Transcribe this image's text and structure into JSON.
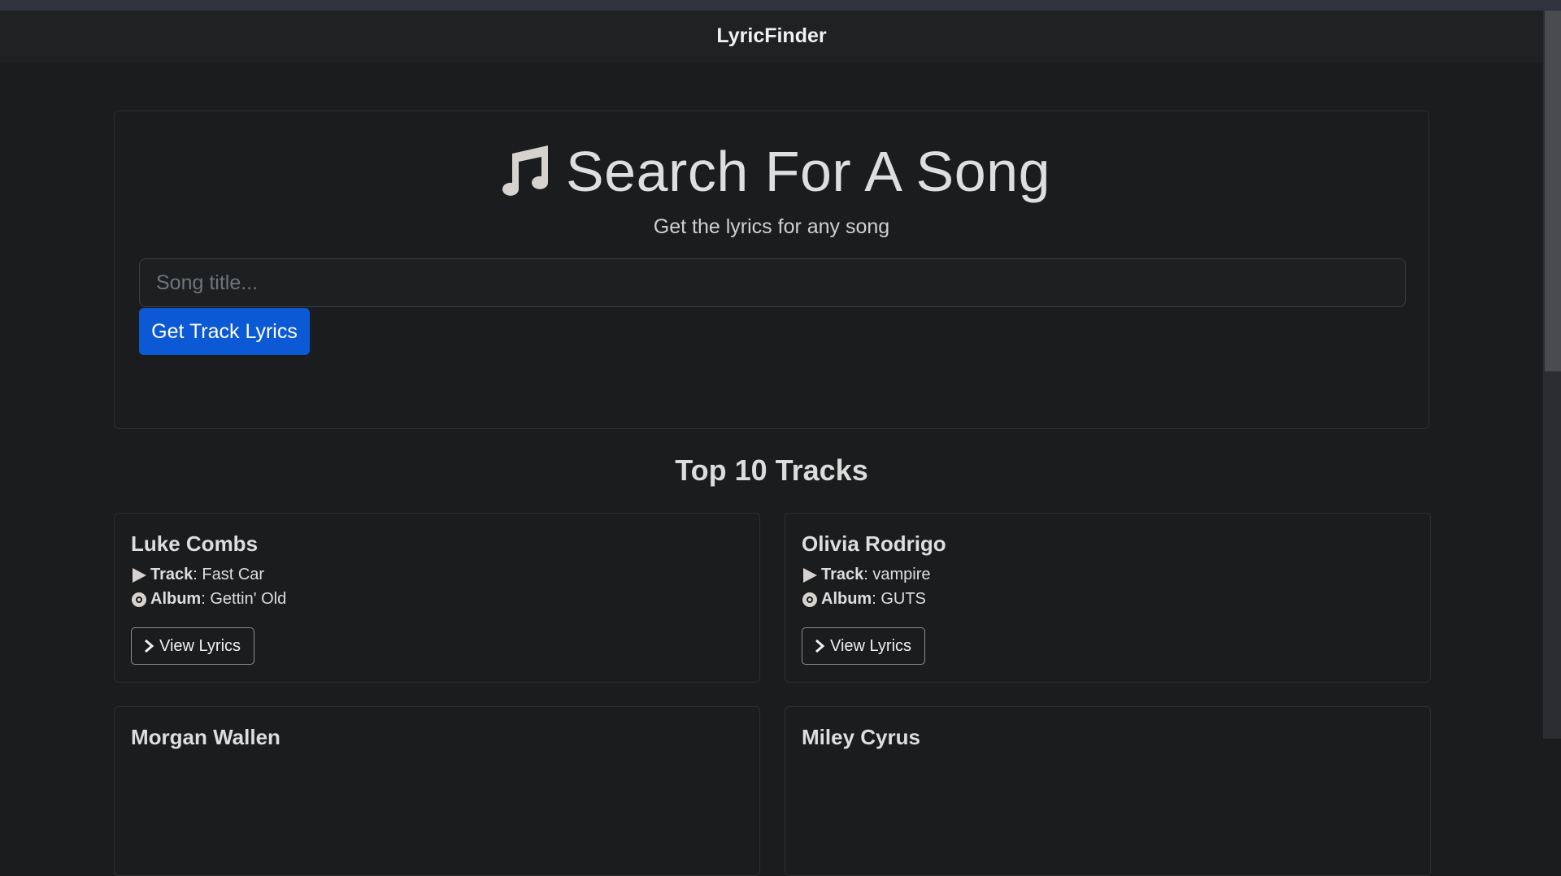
{
  "navbar": {
    "brand": "LyricFinder"
  },
  "search": {
    "title": "Search For A Song",
    "subtitle": "Get the lyrics for any song",
    "placeholder": "Song title...",
    "value": "",
    "button_label": "Get Track Lyrics"
  },
  "tracks_section": {
    "title": "Top 10 Tracks",
    "track_label": "Track",
    "album_label": "Album",
    "view_label": "View Lyrics",
    "items": [
      {
        "artist": "Luke Combs",
        "track": "Fast Car",
        "album": "Gettin' Old"
      },
      {
        "artist": "Olivia Rodrigo",
        "track": "vampire",
        "album": "GUTS"
      },
      {
        "artist": "Morgan Wallen",
        "track": "",
        "album": ""
      },
      {
        "artist": "Miley Cyrus",
        "track": "",
        "album": ""
      }
    ]
  },
  "colors": {
    "background": "#1b1c1e",
    "navbar": "#202123",
    "primary_button": "#0b59d4",
    "text": "#dedede"
  },
  "icons": [
    "music-note-icon",
    "play-icon",
    "disc-icon",
    "chevron-right-icon"
  ]
}
